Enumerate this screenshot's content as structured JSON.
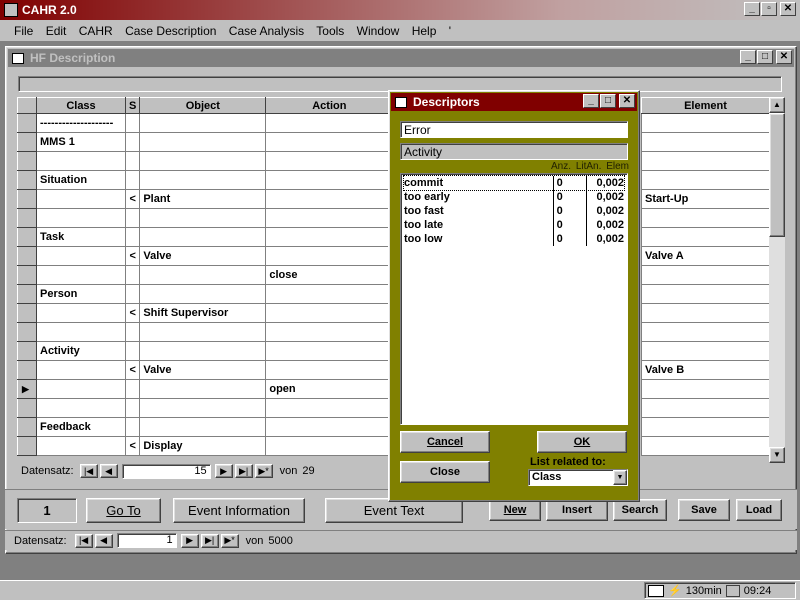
{
  "app": {
    "title": "CAHR 2.0",
    "menu": [
      "File",
      "Edit",
      "CAHR",
      "Case Description",
      "Case Analysis",
      "Tools",
      "Window",
      "Help",
      "'"
    ]
  },
  "child_window": {
    "title": "HF Description",
    "columns": [
      "Class",
      "S",
      "Object",
      "Action",
      "Element"
    ],
    "rows": [
      {
        "class": "--------------------",
        "s": "",
        "object": "",
        "action": "",
        "element": ""
      },
      {
        "class": "MMS  1",
        "s": "",
        "object": "",
        "action": "",
        "element": ""
      },
      {
        "class": "",
        "s": "",
        "object": "",
        "action": "",
        "element": ""
      },
      {
        "class": "Situation",
        "s": "",
        "object": "",
        "action": "",
        "element": ""
      },
      {
        "class": "",
        "s": "<",
        "object": "Plant",
        "action": "",
        "element": "Start-Up"
      },
      {
        "class": "",
        "s": "",
        "object": "",
        "action": "",
        "element": ""
      },
      {
        "class": "Task",
        "s": "",
        "object": "",
        "action": "",
        "element": ""
      },
      {
        "class": "",
        "s": "<",
        "object": "Valve",
        "action": "",
        "element": "Valve A"
      },
      {
        "class": "",
        "s": "",
        "object": "",
        "action": "close",
        "element": ""
      },
      {
        "class": "Person",
        "s": "",
        "object": "",
        "action": "",
        "element": ""
      },
      {
        "class": "",
        "s": "<",
        "object": "Shift Supervisor",
        "action": "",
        "element": ""
      },
      {
        "class": "",
        "s": "",
        "object": "",
        "action": "",
        "element": ""
      },
      {
        "class": "Activity",
        "s": "",
        "object": "",
        "action": "",
        "element": ""
      },
      {
        "class": "",
        "s": "<",
        "object": "Valve",
        "action": "",
        "element": "Valve B"
      },
      {
        "class": "",
        "s": "",
        "object": "",
        "action": "open",
        "element": ""
      },
      {
        "class": "",
        "s": "",
        "object": "",
        "action": "",
        "element": ""
      },
      {
        "class": "Feedback",
        "s": "",
        "object": "",
        "action": "",
        "element": ""
      },
      {
        "class": "",
        "s": "<",
        "object": "Display",
        "action": "",
        "element": ""
      }
    ],
    "current_row_index": 14,
    "record_nav": {
      "label": "Datensatz:",
      "current": "15",
      "of_label": "von",
      "total": "29"
    }
  },
  "bottom_bar": {
    "counter": "1",
    "buttons": {
      "goto": "Go To",
      "event_info": "Event Information",
      "event_text": "Event Text",
      "new": "New",
      "insert": "Insert",
      "search": "Search",
      "save": "Save",
      "load": "Load"
    },
    "record_nav": {
      "label": "Datensatz:",
      "current": "1",
      "of_label": "von",
      "total": "5000"
    }
  },
  "dialog": {
    "title": "Descriptors",
    "field1": "Error",
    "field2": "Activity",
    "list_headers": [
      "Anz.",
      "LitAn.",
      "Elem"
    ],
    "items": [
      {
        "name": "commit",
        "anz": "0",
        "val": "0,002"
      },
      {
        "name": "too early",
        "anz": "0",
        "val": "0,002"
      },
      {
        "name": "too fast",
        "anz": "0",
        "val": "0,002"
      },
      {
        "name": "too late",
        "anz": "0",
        "val": "0,002"
      },
      {
        "name": "too low",
        "anz": "0",
        "val": "0,002"
      }
    ],
    "buttons": {
      "cancel": "Cancel",
      "ok": "OK",
      "close": "Close"
    },
    "related_label": "List related to:",
    "related_value": "Class"
  },
  "taskbar": {
    "time": "09:24",
    "battery": "130min"
  },
  "colors": {
    "titlebar": "#800000",
    "dialog_bg": "#808000",
    "inactive_title": "#808080"
  }
}
